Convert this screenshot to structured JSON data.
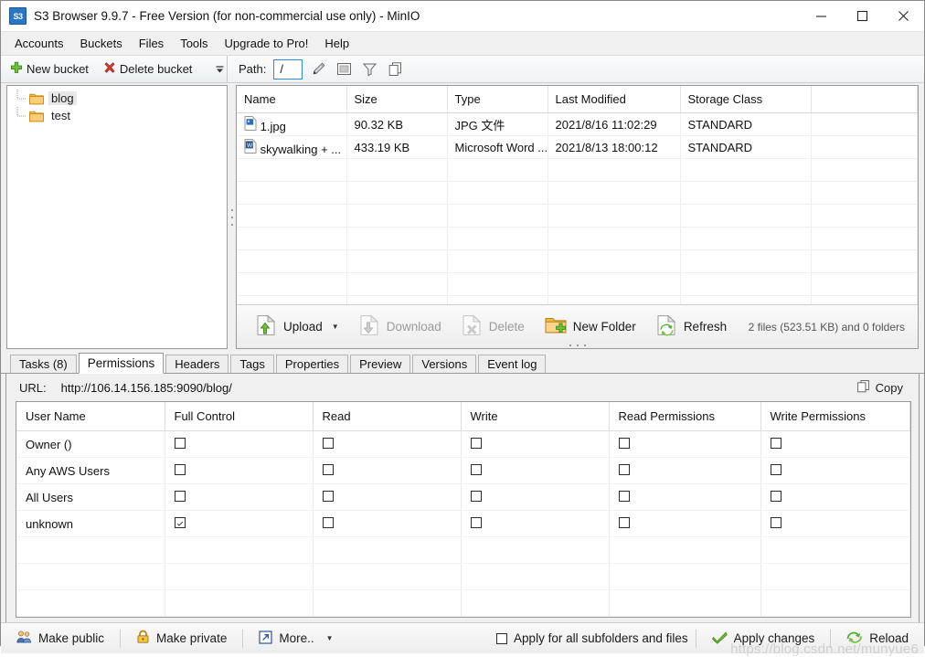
{
  "window": {
    "icon_label": "S3",
    "title": "S3 Browser 9.9.7 - Free Version (for non-commercial use only) - MinIO",
    "controls": {
      "minimize": "minimize-icon",
      "maximize": "maximize-icon",
      "close": "close-icon"
    }
  },
  "menubar": {
    "items": [
      {
        "label": "Accounts"
      },
      {
        "label": "Buckets"
      },
      {
        "label": "Files"
      },
      {
        "label": "Tools"
      },
      {
        "label": "Upgrade to Pro!"
      },
      {
        "label": "Help"
      }
    ]
  },
  "toolbar": {
    "new_bucket": "New bucket",
    "delete_bucket": "Delete bucket",
    "overflow": "chevron-down-icon",
    "path_label": "Path:",
    "path_value": "/",
    "right_icons": [
      {
        "name": "pencil-icon"
      },
      {
        "name": "window-icon"
      },
      {
        "name": "filter-funnel-icon"
      },
      {
        "name": "copy-icon"
      }
    ]
  },
  "tree": {
    "items": [
      {
        "label": "blog",
        "selected": true
      },
      {
        "label": "test",
        "selected": false
      }
    ]
  },
  "filelist": {
    "columns": [
      "Name",
      "Size",
      "Type",
      "Last Modified",
      "Storage Class",
      ""
    ],
    "rows": [
      {
        "icon": "image-file-icon",
        "name": "1.jpg",
        "size": "90.32 KB",
        "type": "JPG 文件",
        "modified": "2021/8/16 11:02:29",
        "storage": "STANDARD"
      },
      {
        "icon": "word-file-icon",
        "name": "skywalking + ...",
        "size": "433.19 KB",
        "type": "Microsoft Word ...",
        "modified": "2021/8/13 18:00:12",
        "storage": "STANDARD"
      }
    ],
    "status": "2 files (523.51 KB) and 0 folders",
    "buttons": [
      {
        "label": "Upload",
        "enabled": true,
        "has_caret": true
      },
      {
        "label": "Download",
        "enabled": false,
        "has_caret": false
      },
      {
        "label": "Delete",
        "enabled": false,
        "has_caret": false
      },
      {
        "label": "New Folder",
        "enabled": true,
        "has_caret": false
      },
      {
        "label": "Refresh",
        "enabled": true,
        "has_caret": false
      }
    ]
  },
  "tabs": [
    {
      "label": "Tasks (8)",
      "active": false
    },
    {
      "label": "Permissions",
      "active": true
    },
    {
      "label": "Headers",
      "active": false
    },
    {
      "label": "Tags",
      "active": false
    },
    {
      "label": "Properties",
      "active": false
    },
    {
      "label": "Preview",
      "active": false
    },
    {
      "label": "Versions",
      "active": false
    },
    {
      "label": "Event log",
      "active": false
    }
  ],
  "permissions": {
    "url_label": "URL:",
    "url_value": "http://106.14.156.185:9090/blog/",
    "copy_label": "Copy",
    "columns": [
      "User Name",
      "Full Control",
      "Read",
      "Write",
      "Read Permissions",
      "Write Permissions"
    ],
    "rows": [
      {
        "user": "Owner ()",
        "full": false,
        "read": false,
        "write": false,
        "readperm": false,
        "writeperm": false
      },
      {
        "user": "Any AWS Users",
        "full": false,
        "read": false,
        "write": false,
        "readperm": false,
        "writeperm": false
      },
      {
        "user": "All Users",
        "full": false,
        "read": false,
        "write": false,
        "readperm": false,
        "writeperm": false
      },
      {
        "user": "unknown",
        "full": true,
        "read": false,
        "write": false,
        "readperm": false,
        "writeperm": false
      }
    ],
    "empty_rows": 3
  },
  "bottombar": {
    "make_public": "Make public",
    "make_private": "Make private",
    "more": "More..",
    "apply_all_label": "Apply for all subfolders and files",
    "apply_all_checked": false,
    "apply_changes": "Apply changes",
    "reload": "Reload"
  },
  "watermark": "https://blog.csdn.net/munyue6",
  "colors": {
    "accent_blue": "#2e8ad8",
    "folder_orange": "#f4a83a",
    "green": "#4aa32e",
    "red": "#c0392b",
    "window_bg": "#f0f0f0"
  }
}
